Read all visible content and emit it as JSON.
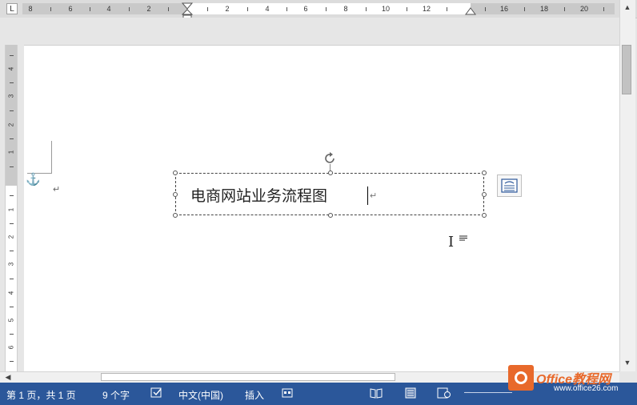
{
  "ruler": {
    "corner_label": "L",
    "numbers_left": [
      "8",
      "6",
      "4",
      "2"
    ],
    "numbers_right": [
      "2",
      "4",
      "6",
      "8",
      "10",
      "12",
      "16",
      "18",
      "20"
    ],
    "vertical_numbers": [
      "4",
      "3",
      "2",
      "1",
      "1",
      "2",
      "3",
      "4",
      "5",
      "6"
    ]
  },
  "document": {
    "textbox_text": "电商网站业务流程图",
    "paragraph_mark": "↵",
    "anchor_icon": "anchor-icon"
  },
  "statusbar": {
    "page": "第 1 页，共 1 页",
    "word_count": "9 个字",
    "language": "中文(中国)",
    "mode": "插入"
  },
  "watermark": {
    "brand": "Office教程网",
    "url": "www.office26.com"
  },
  "colors": {
    "status_bar": "#2b579a",
    "watermark": "#e8692b"
  }
}
